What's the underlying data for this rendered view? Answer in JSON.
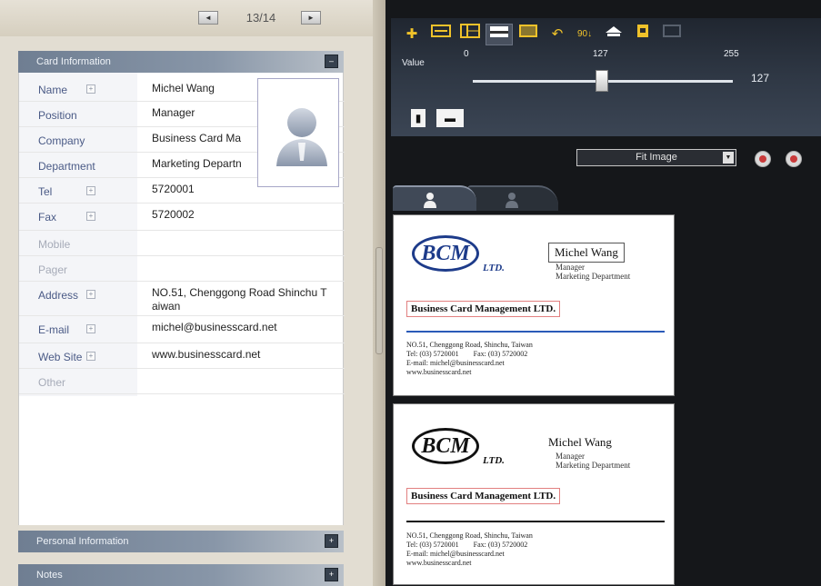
{
  "pager": {
    "prev_label": "◄",
    "page_text": "13/14",
    "next_label": "►"
  },
  "card_info": {
    "header": "Card Information",
    "collapse_label": "–",
    "fields": [
      {
        "label": "Name",
        "value": "Michel Wang",
        "expandable": true,
        "dim": false
      },
      {
        "label": "Position",
        "value": "Manager",
        "expandable": false,
        "dim": false
      },
      {
        "label": "Company",
        "value": "Business Card Ma",
        "expandable": false,
        "dim": false
      },
      {
        "label": "Department",
        "value": "Marketing Departn",
        "expandable": false,
        "dim": false
      },
      {
        "label": "Tel",
        "value": "5720001",
        "expandable": true,
        "dim": false
      },
      {
        "label": "Fax",
        "value": "5720002",
        "expandable": true,
        "dim": false
      },
      {
        "label": "Mobile",
        "value": "",
        "expandable": false,
        "dim": true
      },
      {
        "label": "Pager",
        "value": "",
        "expandable": false,
        "dim": true
      },
      {
        "label": "Address",
        "value": "NO.51, Chenggong Road Shinchu T",
        "value2": "aiwan",
        "expandable": true,
        "dim": false
      },
      {
        "label": "E-mail",
        "value": "michel@businesscard.net",
        "expandable": true,
        "dim": false
      },
      {
        "label": "Web Site",
        "value": "www.businesscard.net",
        "expandable": true,
        "dim": false
      },
      {
        "label": "Other",
        "value": "",
        "expandable": false,
        "dim": true
      }
    ],
    "expand_glyph": "+"
  },
  "personal_header": "Personal Information",
  "notes_header": "Notes",
  "panel_expand_label": "+",
  "toolbar": {
    "value_label": "Value",
    "ticks": [
      "0",
      "127",
      "255"
    ],
    "slider_value": "127",
    "slider_fraction": 0.498,
    "rotate_label": "90"
  },
  "image_view": {
    "fit_label": "Fit Image",
    "dropdown_arrow": "▼"
  },
  "business_card": {
    "logo_text": "BCM",
    "ltd_text": "LTD.",
    "name": "Michel Wang",
    "title": "Manager",
    "department": "Marketing Department",
    "company": "Business Card Management LTD.",
    "address_line1": "NO.51, Chenggong Road, Shinchu, Taiwan",
    "address_line2": "Tel: (03) 5720001        Fax: (03) 5720002",
    "address_line3": "E-mail: michel@businesscard.net",
    "address_line4": "www.businesscard.net"
  },
  "colors": {
    "card_logo_blue": "#1d3b8a",
    "highlight_red": "#e28080",
    "toolbar_icon": "#f0c22a"
  }
}
